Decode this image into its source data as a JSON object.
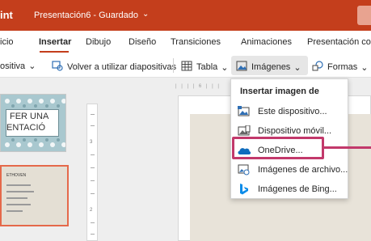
{
  "titlebar": {
    "app_name": "int",
    "document_title": "Presentación6 - Guardado",
    "chevron": "⌄"
  },
  "ribbon_tabs": [
    {
      "label": "icio"
    },
    {
      "label": "Insertar"
    },
    {
      "label": "Dibujo"
    },
    {
      "label": "Diseño"
    },
    {
      "label": "Transiciones"
    },
    {
      "label": "Animaciones"
    },
    {
      "label": "Presentación con"
    }
  ],
  "toolbar": {
    "new_slide_partial": "ositiva",
    "new_slide_chevron": "⌄",
    "reuse_slides": "Volver a utilizar diapositivas",
    "table": "Tabla",
    "table_chevron": "⌄",
    "images": "Imágenes",
    "images_chevron": "⌄",
    "shapes": "Formas",
    "shapes_chevron": "⌄"
  },
  "thumbnails": {
    "slide1_line1": "FER UNA",
    "slide1_line2": "ENTACIÓ",
    "slide2_title": "ETHOVEN"
  },
  "ruler": {
    "h_marks": "| | | | 6 | | |",
    "v_num_1": "3",
    "v_num_2": "2"
  },
  "image_menu": {
    "header": "Insertar imagen de",
    "items": [
      {
        "label": "Este dispositivo...",
        "icon": "device-image-icon"
      },
      {
        "label": "Dispositivo móvil...",
        "icon": "mobile-image-icon"
      },
      {
        "label": "OneDrive...",
        "icon": "onedrive-cloud-icon"
      },
      {
        "label": "Imágenes de archivo...",
        "icon": "stock-images-icon"
      },
      {
        "label": "Imágenes de Bing...",
        "icon": "bing-icon"
      }
    ]
  },
  "colors": {
    "titlebar_bg": "#c43e1c",
    "highlight_border": "#c2396b",
    "onedrive_blue": "#0f6cbd",
    "bing_blue": "#0c8ce9"
  }
}
